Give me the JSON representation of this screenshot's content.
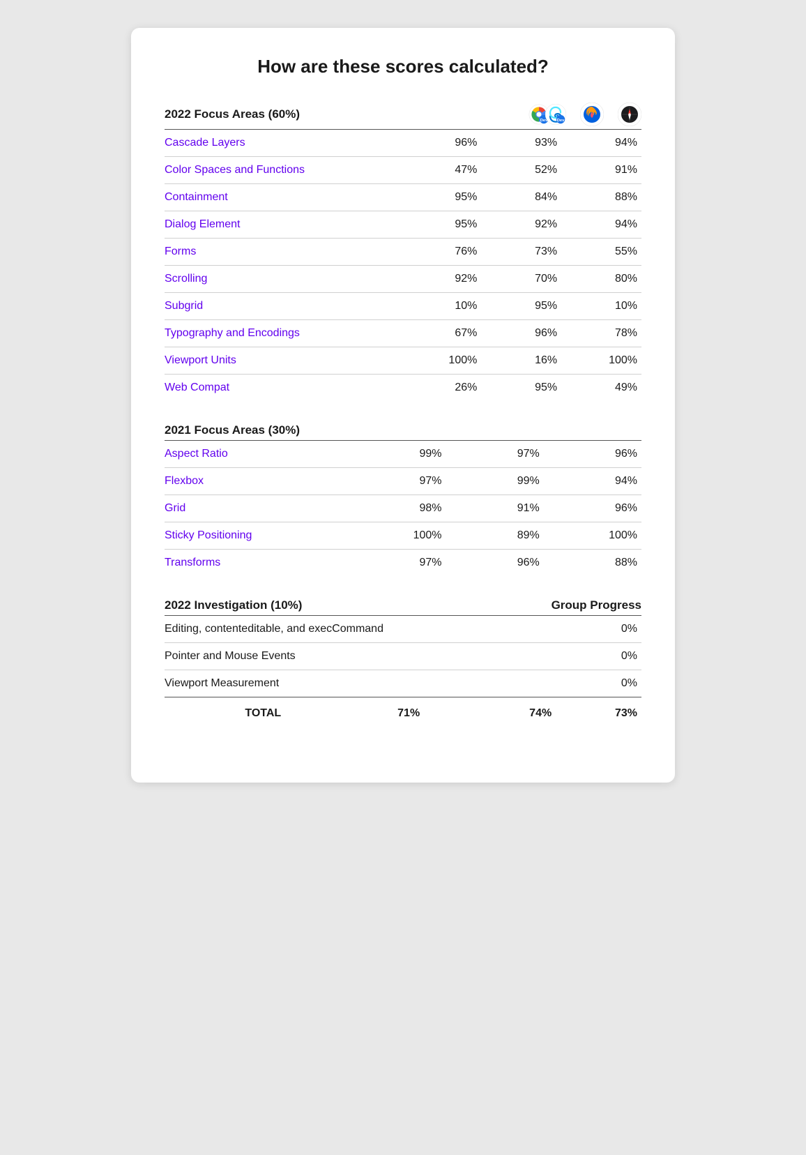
{
  "page": {
    "title": "How are these scores calculated?"
  },
  "section2022": {
    "title": "2022 Focus Areas (60%)",
    "rows": [
      {
        "name": "Cascade Layers",
        "col1": "96%",
        "col2": "93%",
        "col3": "94%"
      },
      {
        "name": "Color Spaces and Functions",
        "col1": "47%",
        "col2": "52%",
        "col3": "91%"
      },
      {
        "name": "Containment",
        "col1": "95%",
        "col2": "84%",
        "col3": "88%"
      },
      {
        "name": "Dialog Element",
        "col1": "95%",
        "col2": "92%",
        "col3": "94%"
      },
      {
        "name": "Forms",
        "col1": "76%",
        "col2": "73%",
        "col3": "55%"
      },
      {
        "name": "Scrolling",
        "col1": "92%",
        "col2": "70%",
        "col3": "80%"
      },
      {
        "name": "Subgrid",
        "col1": "10%",
        "col2": "95%",
        "col3": "10%"
      },
      {
        "name": "Typography and Encodings",
        "col1": "67%",
        "col2": "96%",
        "col3": "78%"
      },
      {
        "name": "Viewport Units",
        "col1": "100%",
        "col2": "16%",
        "col3": "100%"
      },
      {
        "name": "Web Compat",
        "col1": "26%",
        "col2": "95%",
        "col3": "49%"
      }
    ]
  },
  "section2021": {
    "title": "2021 Focus Areas (30%)",
    "rows": [
      {
        "name": "Aspect Ratio",
        "col1": "99%",
        "col2": "97%",
        "col3": "96%"
      },
      {
        "name": "Flexbox",
        "col1": "97%",
        "col2": "99%",
        "col3": "94%"
      },
      {
        "name": "Grid",
        "col1": "98%",
        "col2": "91%",
        "col3": "96%"
      },
      {
        "name": "Sticky Positioning",
        "col1": "100%",
        "col2": "89%",
        "col3": "100%"
      },
      {
        "name": "Transforms",
        "col1": "97%",
        "col2": "96%",
        "col3": "88%"
      }
    ]
  },
  "section2022inv": {
    "title": "2022 Investigation (10%)",
    "group_progress": "Group Progress",
    "rows": [
      {
        "name": "Editing, contenteditable, and execCommand",
        "col3": "0%"
      },
      {
        "name": "Pointer and Mouse Events",
        "col3": "0%"
      },
      {
        "name": "Viewport Measurement",
        "col3": "0%"
      }
    ]
  },
  "totals": {
    "label": "TOTAL",
    "col1": "71%",
    "col2": "74%",
    "col3": "73%"
  }
}
